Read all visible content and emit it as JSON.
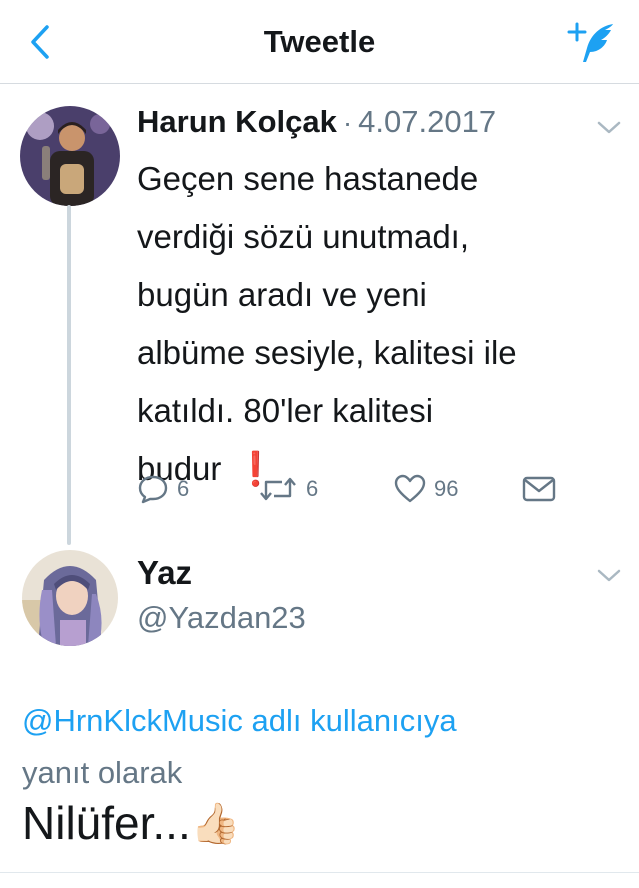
{
  "nav": {
    "title": "Tweetle",
    "back_icon": "chevron-left-icon",
    "compose_icon": "compose-feather-icon",
    "accent_color": "#1da1f2"
  },
  "tweet": {
    "author": "Harun Kolçak",
    "separator": "·",
    "date": "4.07.2017",
    "text": "Geçen sene hastanede\nverdiği sözü unutmadı,\nbugün aradı ve yeni\nalbüme sesiyle, kalitesi ile\nkatıldı. 80'ler kalitesi\nbudur",
    "emoji": "❗",
    "actions": {
      "reply_count": "6",
      "retweet_count": "6",
      "like_count": "96"
    }
  },
  "reply": {
    "author": "Yaz",
    "handle": "@Yazdan23",
    "reply_to_mention": "@HrnKlckMusic adlı kullanıcıya",
    "reply_to_suffix": "yanıt olarak",
    "text": "Nilüfer...",
    "emoji": "👍🏻"
  }
}
